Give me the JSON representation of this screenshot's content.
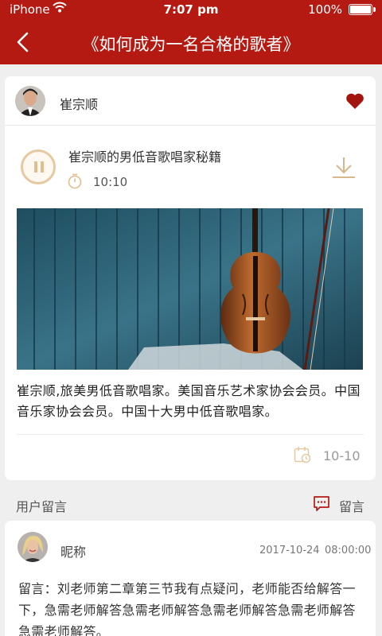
{
  "status_bar": {
    "carrier": "iPhone",
    "time": "7:07 pm",
    "battery": "100%"
  },
  "header": {
    "title": "《如何成为一名合格的歌者》"
  },
  "author": {
    "name": "崔宗顺"
  },
  "track": {
    "title": "崔宗顺的男低音歌唱家秘籍",
    "duration": "10:10"
  },
  "description": "崔宗顺,旅美男低音歌唱家。美国音乐艺术家协会会员。中国音乐家协会会员。中国十大男中低音歌唱家。",
  "post_date": "10-10",
  "comments_section": {
    "title": "用户留言",
    "action_label": "留言"
  },
  "comment": {
    "nickname": "昵称",
    "date": "2017-10-24",
    "time": "08:00:00",
    "text": "留言：刘老师第二章第三节我有点疑问，老师能否给解答一下，急需老师解答急需老师解答急需老师解答急需老师解答急需老师解答。"
  },
  "colors": {
    "brand": "#b51a12",
    "accent_gold": "#e0be8e"
  },
  "icons": [
    "back-arrow-icon",
    "heart-icon",
    "pause-icon",
    "timer-icon",
    "download-icon",
    "calendar-icon",
    "message-icon",
    "wifi-icon",
    "battery-icon"
  ]
}
